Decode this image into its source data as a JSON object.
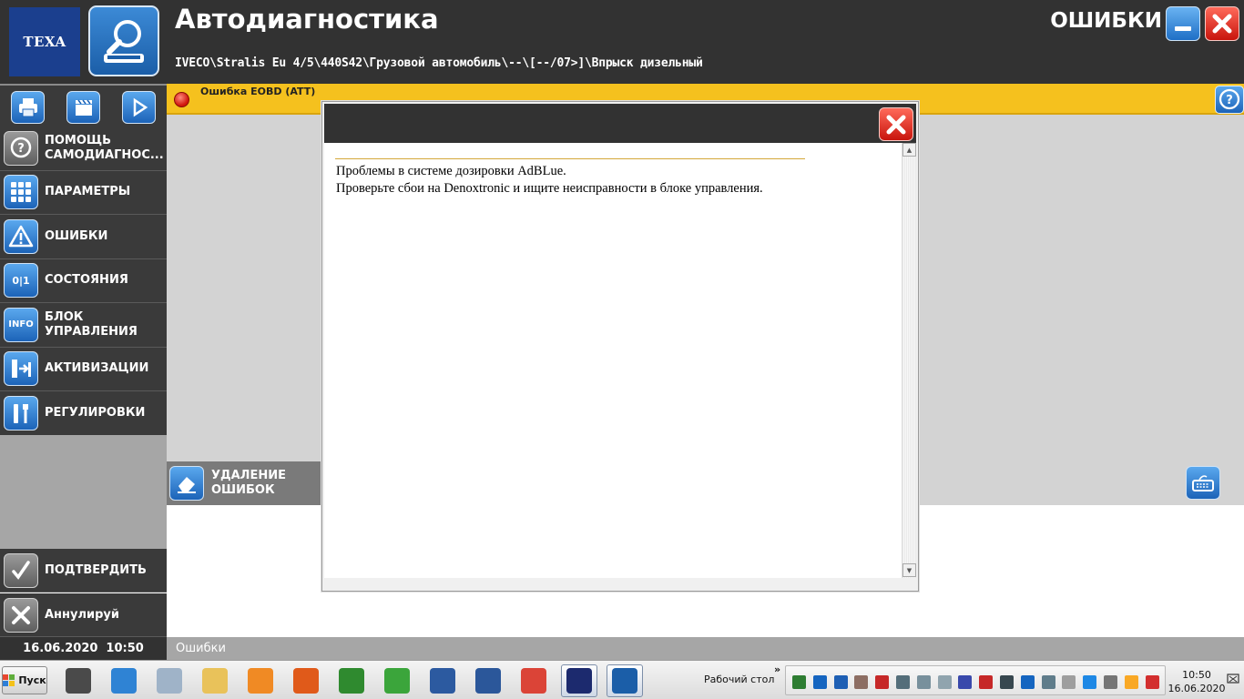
{
  "header": {
    "brand_logo": "TEXA",
    "app_icon": "magnifier-truck-icon",
    "app_title": "Автодиагностика",
    "vehicle_path": "IVECO\\Stralis Eu 4/5\\440S42\\Грузовой автомобиль\\--\\[--/07>]\\Впрыск дизельный",
    "section_title": "ОШИБКИ"
  },
  "toolbar": {
    "icons": [
      "printer-icon",
      "clapperboard-icon",
      "play-icon"
    ]
  },
  "nav": {
    "items": [
      {
        "icon": "help-bubble-icon",
        "label": "ПОМОЩЬ\nСАМОДИАГНОС..."
      },
      {
        "icon": "grid-icon",
        "label": "ПАРАМЕТРЫ"
      },
      {
        "icon": "warning-triangle-icon",
        "label": "ОШИБКИ"
      },
      {
        "icon": "binary-icon",
        "icon_text": "0|1",
        "label": "СОСТОЯНИЯ"
      },
      {
        "icon": "info-icon",
        "icon_text": "INFO",
        "label": "БЛОК\nУПРАВЛЕНИЯ"
      },
      {
        "icon": "activation-icon",
        "label": "АКТИВИЗАЦИИ"
      },
      {
        "icon": "tools-icon",
        "label": "РЕГУЛИРОВКИ"
      }
    ],
    "confirm_label": "ПОДТВЕРДИТЬ",
    "cancel_label": "Аннулируй"
  },
  "datetime": {
    "date": "16.06.2020",
    "time": "10:50"
  },
  "error_bar": {
    "text": "Ошибка EOBD (ATT)"
  },
  "main": {
    "delete_label": "УДАЛЕНИЕ\nОШИБОК",
    "status_text": "Ошибки"
  },
  "dialog": {
    "line1": "Проблемы в системе дозировки AdBLue.",
    "line2": "Проверьте сбои на Denoxtronic и ищите неисправности в блоке управления."
  },
  "taskbar": {
    "start_label": "Пуск",
    "desktop_label": "Рабочий стол",
    "clock_time": "10:50",
    "clock_date": "16.06.2020",
    "apps": [
      {
        "name": "idc4-icon",
        "color": "#4a4a4a"
      },
      {
        "name": "internet-explorer-icon",
        "color": "#2f83d4"
      },
      {
        "name": "calculator-icon",
        "color": "#9fb3c8"
      },
      {
        "name": "file-explorer-icon",
        "color": "#e9c25a"
      },
      {
        "name": "media-player-icon",
        "color": "#f08a24"
      },
      {
        "name": "fan-app-icon",
        "color": "#e05a1a"
      },
      {
        "name": "oscilloscope-icon",
        "color": "#2f8a2f"
      },
      {
        "name": "prism-app-icon",
        "color": "#3ba53b"
      },
      {
        "name": "ed-app-icon",
        "color": "#2c5aa0"
      },
      {
        "name": "word-icon",
        "color": "#2b579a"
      },
      {
        "name": "chrome-icon",
        "color": "#db4437"
      },
      {
        "name": "window-app-icon",
        "color": "#1c2a6e"
      },
      {
        "name": "texa-autodiag-icon",
        "color": "#1b5ea8"
      }
    ],
    "tray_icons": [
      {
        "name": "tray-app-icon",
        "color": "#2e7d32"
      },
      {
        "name": "tray-shield-icon",
        "color": "#1565c0"
      },
      {
        "name": "bluetooth-icon",
        "color": "#1e5fb4"
      },
      {
        "name": "tray-antenna-icon",
        "color": "#8d6e63"
      },
      {
        "name": "tray-bag-icon",
        "color": "#c62828"
      },
      {
        "name": "tray-plug-icon",
        "color": "#546e7a"
      },
      {
        "name": "tray-disk-icon",
        "color": "#78909c"
      },
      {
        "name": "tray-mail-icon",
        "color": "#90a4ae"
      },
      {
        "name": "tray-ed-icon",
        "color": "#3949ab"
      },
      {
        "name": "volume-icon",
        "color": "#c62828"
      },
      {
        "name": "tray-monitor-icon",
        "color": "#37474f"
      },
      {
        "name": "tray-phone-icon",
        "color": "#1565c0"
      },
      {
        "name": "tray-usb-icon",
        "color": "#607d8b"
      },
      {
        "name": "tray-speaker-icon",
        "color": "#9e9e9e"
      },
      {
        "name": "tray-info-icon",
        "color": "#1e88e5"
      },
      {
        "name": "tray-sync-icon",
        "color": "#757575"
      },
      {
        "name": "signal-bars-icon",
        "color": "#f9a825"
      },
      {
        "name": "network-error-icon",
        "color": "#d32f2f"
      }
    ]
  }
}
